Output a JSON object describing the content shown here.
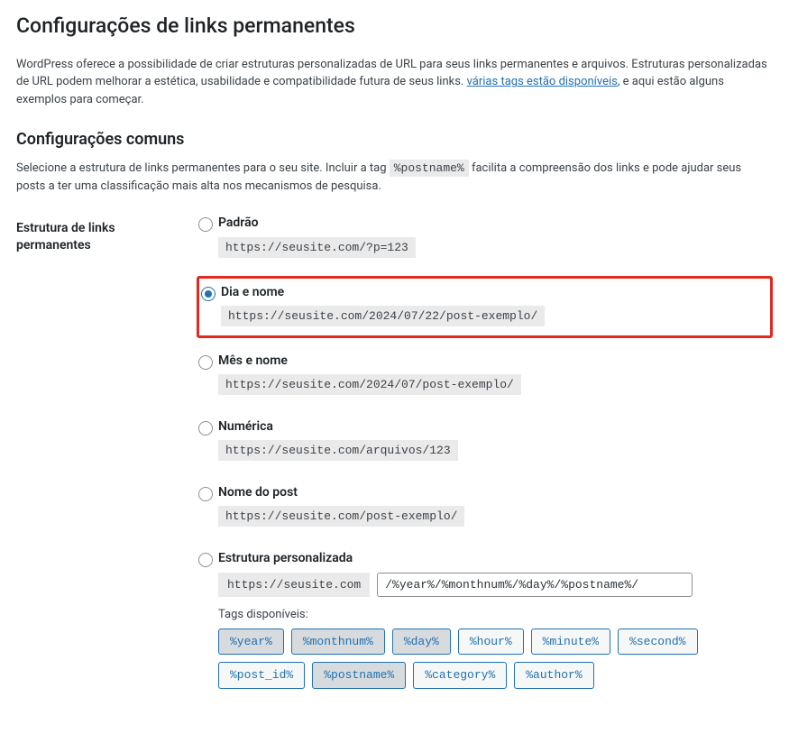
{
  "page_title": "Configurações de links permanentes",
  "intro": {
    "part1": "WordPress oferece a possibilidade de criar estruturas personalizadas de URL para seus links permanentes e arquivos. Estruturas personalizadas de URL podem melhorar a estética, usabilidade e compatibilidade futura de seus links. ",
    "link_text": "várias tags estão disponíveis",
    "part2": ", e aqui estão alguns exemplos para começar."
  },
  "common_heading": "Configurações comuns",
  "common_desc": {
    "part1": "Selecione a estrutura de links permanentes para o seu site. Incluir a tag ",
    "tag": "%postname%",
    "part2": " facilita a compreensão dos links e pode ajudar seus posts a ter uma classificação mais alta nos mecanismos de pesquisa."
  },
  "structure_th": "Estrutura de links permanentes",
  "options": {
    "default": {
      "label": "Padrão",
      "example": "https://seusite.com/?p=123"
    },
    "day_name": {
      "label": "Dia e nome",
      "example": "https://seusite.com/2024/07/22/post-exemplo/"
    },
    "month_name": {
      "label": "Mês e nome",
      "example": "https://seusite.com/2024/07/post-exemplo/"
    },
    "numeric": {
      "label": "Numérica",
      "example": "https://seusite.com/arquivos/123"
    },
    "post_name": {
      "label": "Nome do post",
      "example": "https://seusite.com/post-exemplo/"
    },
    "custom": {
      "label": "Estrutura personalizada",
      "base": "https://seusite.com",
      "value": "/%year%/%monthnum%/%day%/%postname%/",
      "available_label": "Tags disponíveis:",
      "tags": [
        "%year%",
        "%monthnum%",
        "%day%",
        "%hour%",
        "%minute%",
        "%second%",
        "%post_id%",
        "%postname%",
        "%category%",
        "%author%"
      ],
      "active_tags": [
        "%year%",
        "%monthnum%",
        "%day%",
        "%postname%"
      ]
    }
  },
  "selected": "day_name"
}
